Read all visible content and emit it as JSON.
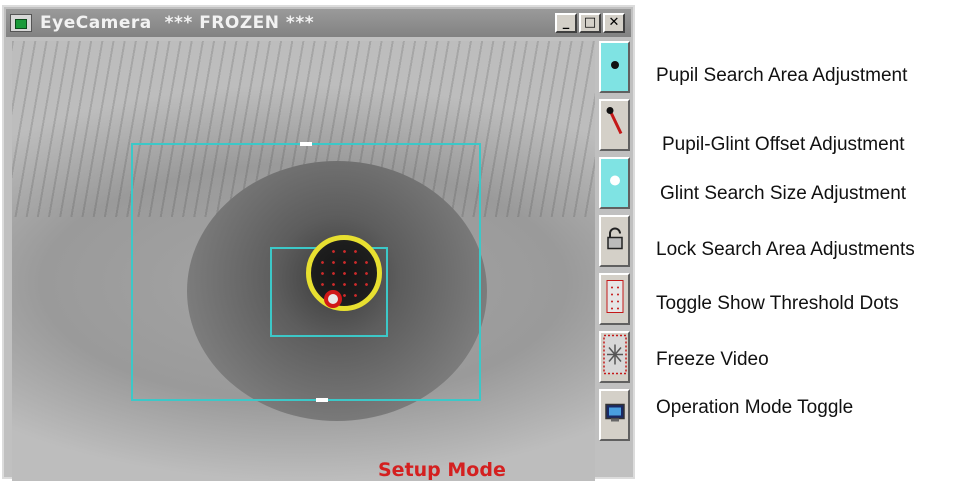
{
  "window": {
    "title": "EyeCamera  *** FROZEN ***",
    "minimize_glyph": "_",
    "maximize_glyph": "□",
    "close_glyph": "✕"
  },
  "video": {
    "mode_label": "Setup Mode"
  },
  "toolbar": [
    {
      "icon": "pupil-dot-icon",
      "label": "Pupil Search Area Adjustment",
      "active": true
    },
    {
      "icon": "offset-pointer-icon",
      "label": "Pupil-Glint Offset Adjustment",
      "active": false
    },
    {
      "icon": "glint-dot-icon",
      "label": "Glint Search Size Adjustment",
      "active": true
    },
    {
      "icon": "lock-icon",
      "label": "Lock Search Area Adjustments",
      "active": false
    },
    {
      "icon": "threshold-dots-icon",
      "label": "Toggle Show Threshold Dots",
      "active": false
    },
    {
      "icon": "freeze-icon",
      "label": "Freeze Video",
      "active": false
    },
    {
      "icon": "monitor-icon",
      "label": "Operation Mode Toggle",
      "active": false
    }
  ],
  "colors": {
    "search_box": "#3cc8c8",
    "pupil_ring": "#e8e030",
    "mode_label": "#d42020",
    "active_tool": "#7fe3e3"
  }
}
